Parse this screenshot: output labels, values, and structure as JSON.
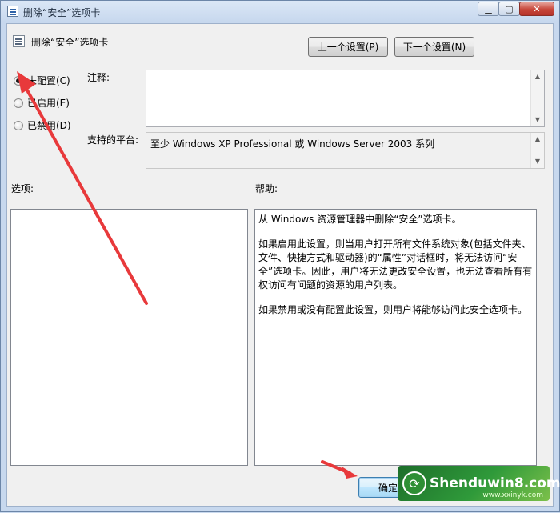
{
  "window": {
    "title": "删除“安全”选项卡",
    "controls": {
      "minimize": "▁",
      "maximize": "▢",
      "close": "✕"
    }
  },
  "header": {
    "title": "删除“安全”选项卡"
  },
  "nav": {
    "prev_label": "上一个设置(P)",
    "next_label": "下一个设置(N)"
  },
  "radios": [
    {
      "label": "未配置(C)",
      "checked": true
    },
    {
      "label": "已启用(E)",
      "checked": false
    },
    {
      "label": "已禁用(D)",
      "checked": false
    }
  ],
  "comment": {
    "label": "注释:",
    "value": ""
  },
  "platform": {
    "label": "支持的平台:",
    "value": "至少 Windows XP Professional 或 Windows Server 2003 系列"
  },
  "options": {
    "label": "选项:"
  },
  "help": {
    "label": "帮助:",
    "paragraphs": [
      "从 Windows 资源管理器中删除“安全”选项卡。",
      "如果启用此设置，则当用户打开所有文件系统对象(包括文件夹、文件、快捷方式和驱动器)的“属性”对话框时，将无法访问“安全”选项卡。因此，用户将无法更改安全设置，也无法查看所有有权访问有问题的资源的用户列表。",
      "如果禁用或没有配置此设置，则用户将能够访问此安全选项卡。"
    ]
  },
  "footer": {
    "ok_label": "确定"
  },
  "watermark": {
    "text": "Shenduwin8.com",
    "subtext": "www.xxinyk.com"
  },
  "colors": {
    "annotation_arrow": "#e8393b"
  }
}
